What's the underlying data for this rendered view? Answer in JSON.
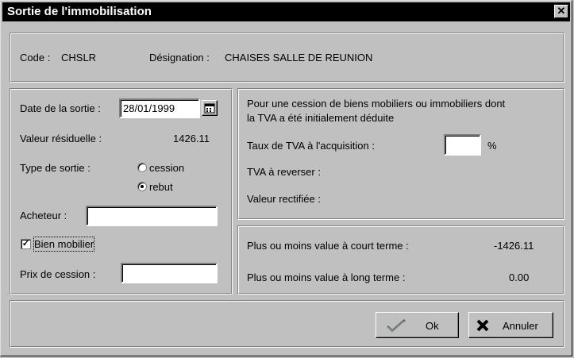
{
  "window": {
    "title": "Sortie de l'immobilisation",
    "close_glyph": "✕"
  },
  "header": {
    "code_label": "Code :",
    "code_value": "CHSLR",
    "designation_label": "Désignation :",
    "designation_value": "CHAISES SALLE DE REUNION"
  },
  "left": {
    "date_label": "Date de la sortie :",
    "date_value": "28/01/1999",
    "residual_label": "Valeur résiduelle :",
    "residual_value": "1426.11",
    "type_label": "Type de sortie :",
    "radio_cession": "cession",
    "radio_rebut": "rebut",
    "selected_type": "rebut",
    "buyer_label": "Acheteur :",
    "buyer_value": "",
    "movable_label": "Bien mobilier",
    "movable_checked": true,
    "price_label": "Prix de cession :",
    "price_value": ""
  },
  "tva": {
    "intro_line1": "Pour une cession de biens mobiliers ou immobiliers dont",
    "intro_line2": "la TVA a été initialement déduite",
    "rate_label": "Taux de TVA à l'acquisition :",
    "rate_value": "",
    "rate_unit": "%",
    "reverse_label": "TVA à reverser :",
    "rectified_label": "Valeur rectifiée :"
  },
  "gains": {
    "short_label": "Plus ou moins value à court terme :",
    "short_value": "-1426.11",
    "long_label": "Plus ou moins value à long terme :",
    "long_value": "0.00"
  },
  "buttons": {
    "ok_label": "Ok",
    "cancel_label": "Annuler"
  },
  "icons": {
    "calendar": "calendar-icon",
    "ok": "check-icon",
    "cancel": "x-icon"
  }
}
